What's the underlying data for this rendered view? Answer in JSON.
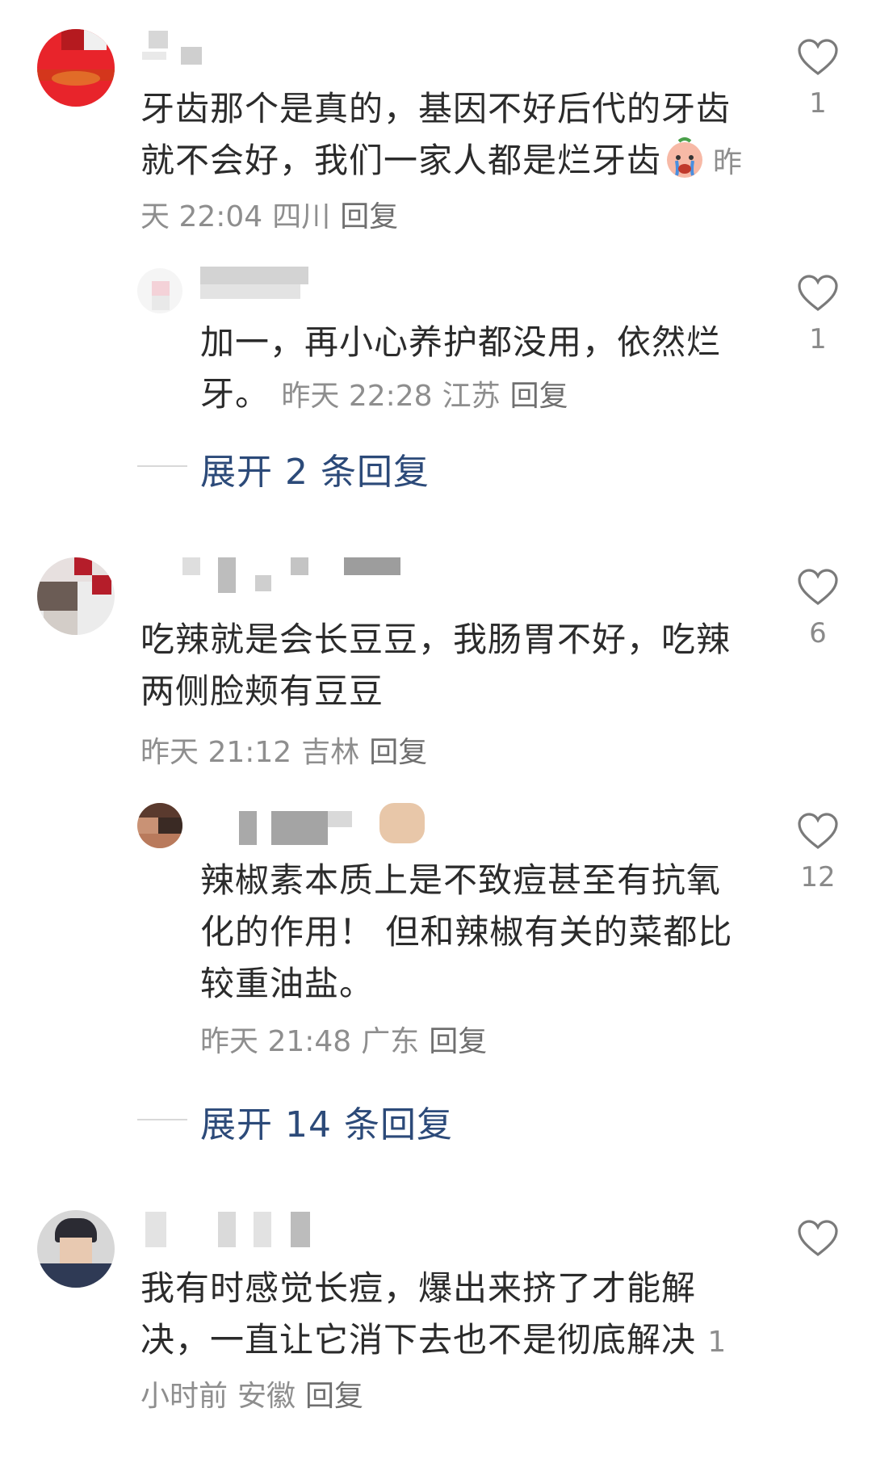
{
  "comments": [
    {
      "text": "牙齿那个是真的，基因不好后代的牙齿就不会好，我们一家人都是烂牙齿",
      "emoji": "crying-face-emoji",
      "time": "昨天 22:04",
      "location": "四川",
      "reply_label": "回复",
      "likes": "1",
      "replies": [
        {
          "text": "加一，再小心养护都没用，依然烂牙。",
          "time": "昨天 22:28",
          "location": "江苏",
          "reply_label": "回复",
          "likes": "1"
        }
      ],
      "expand_label": "展开 2 条回复"
    },
    {
      "text": "吃辣就是会长豆豆，我肠胃不好，吃辣两侧脸颊有豆豆",
      "time": "昨天 21:12",
      "location": "吉林",
      "reply_label": "回复",
      "likes": "6",
      "replies": [
        {
          "text": "辣椒素本质上是不致痘甚至有抗氧化的作用！ 但和辣椒有关的菜都比较重油盐。",
          "time": "昨天 21:48",
          "location": "广东",
          "reply_label": "回复",
          "likes": "12"
        }
      ],
      "expand_label": "展开 14 条回复"
    },
    {
      "text": "我有时感觉长痘，爆出来挤了才能解决，一直让它消下去也不是彻底解决",
      "time": "1小时前",
      "location": "安徽",
      "reply_label": "回复",
      "likes": ""
    }
  ],
  "colors": {
    "text": "#2b2b2b",
    "meta": "#8e8e8e",
    "expand_link": "#2c4a79",
    "heart_outline": "#7a7a7a"
  }
}
